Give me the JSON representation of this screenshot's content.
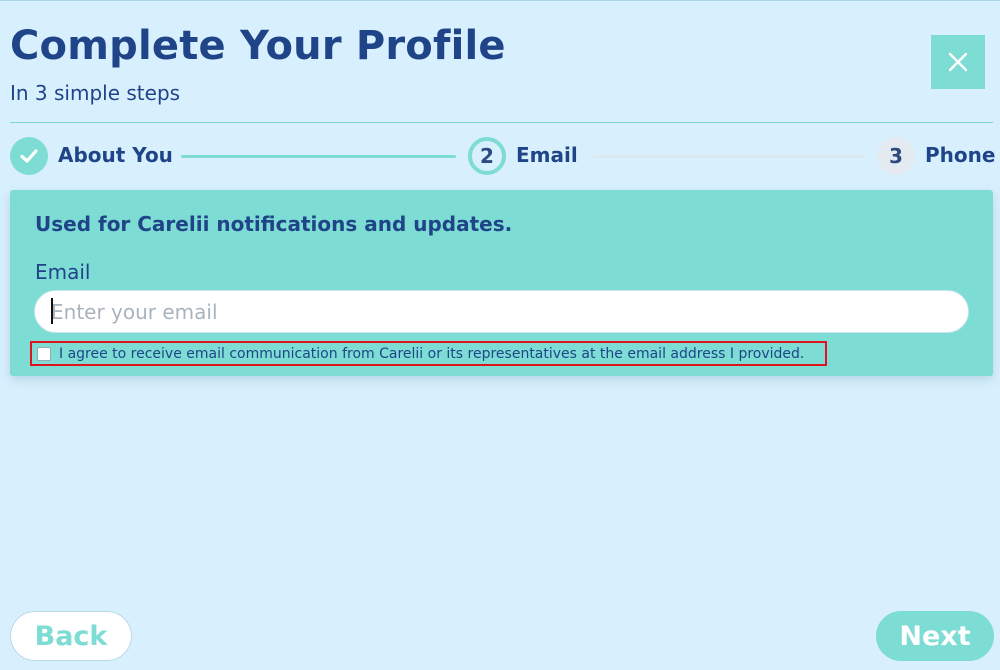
{
  "header": {
    "title": "Complete Your Profile",
    "subtitle": "In 3 simple steps"
  },
  "stepper": {
    "steps": [
      {
        "number": "",
        "label": "About You",
        "state": "completed"
      },
      {
        "number": "2",
        "label": "Email",
        "state": "active"
      },
      {
        "number": "3",
        "label": "Phone",
        "state": "upcoming"
      }
    ]
  },
  "form": {
    "description": "Used for Carelii notifications and updates.",
    "email_label": "Email",
    "email_placeholder": "Enter your email",
    "email_value": "",
    "consent_text": "I agree to receive email communication from Carelii or its representatives at the email address I provided.",
    "consent_checked": false
  },
  "footer": {
    "back_label": "Back",
    "next_label": "Next"
  },
  "icons": {
    "close": "close-icon",
    "check": "check-icon"
  },
  "colors": {
    "background": "#d8f0fd",
    "accent": "#7ddcd3",
    "primary_text": "#1f4488",
    "highlight_border": "#e0141e"
  }
}
